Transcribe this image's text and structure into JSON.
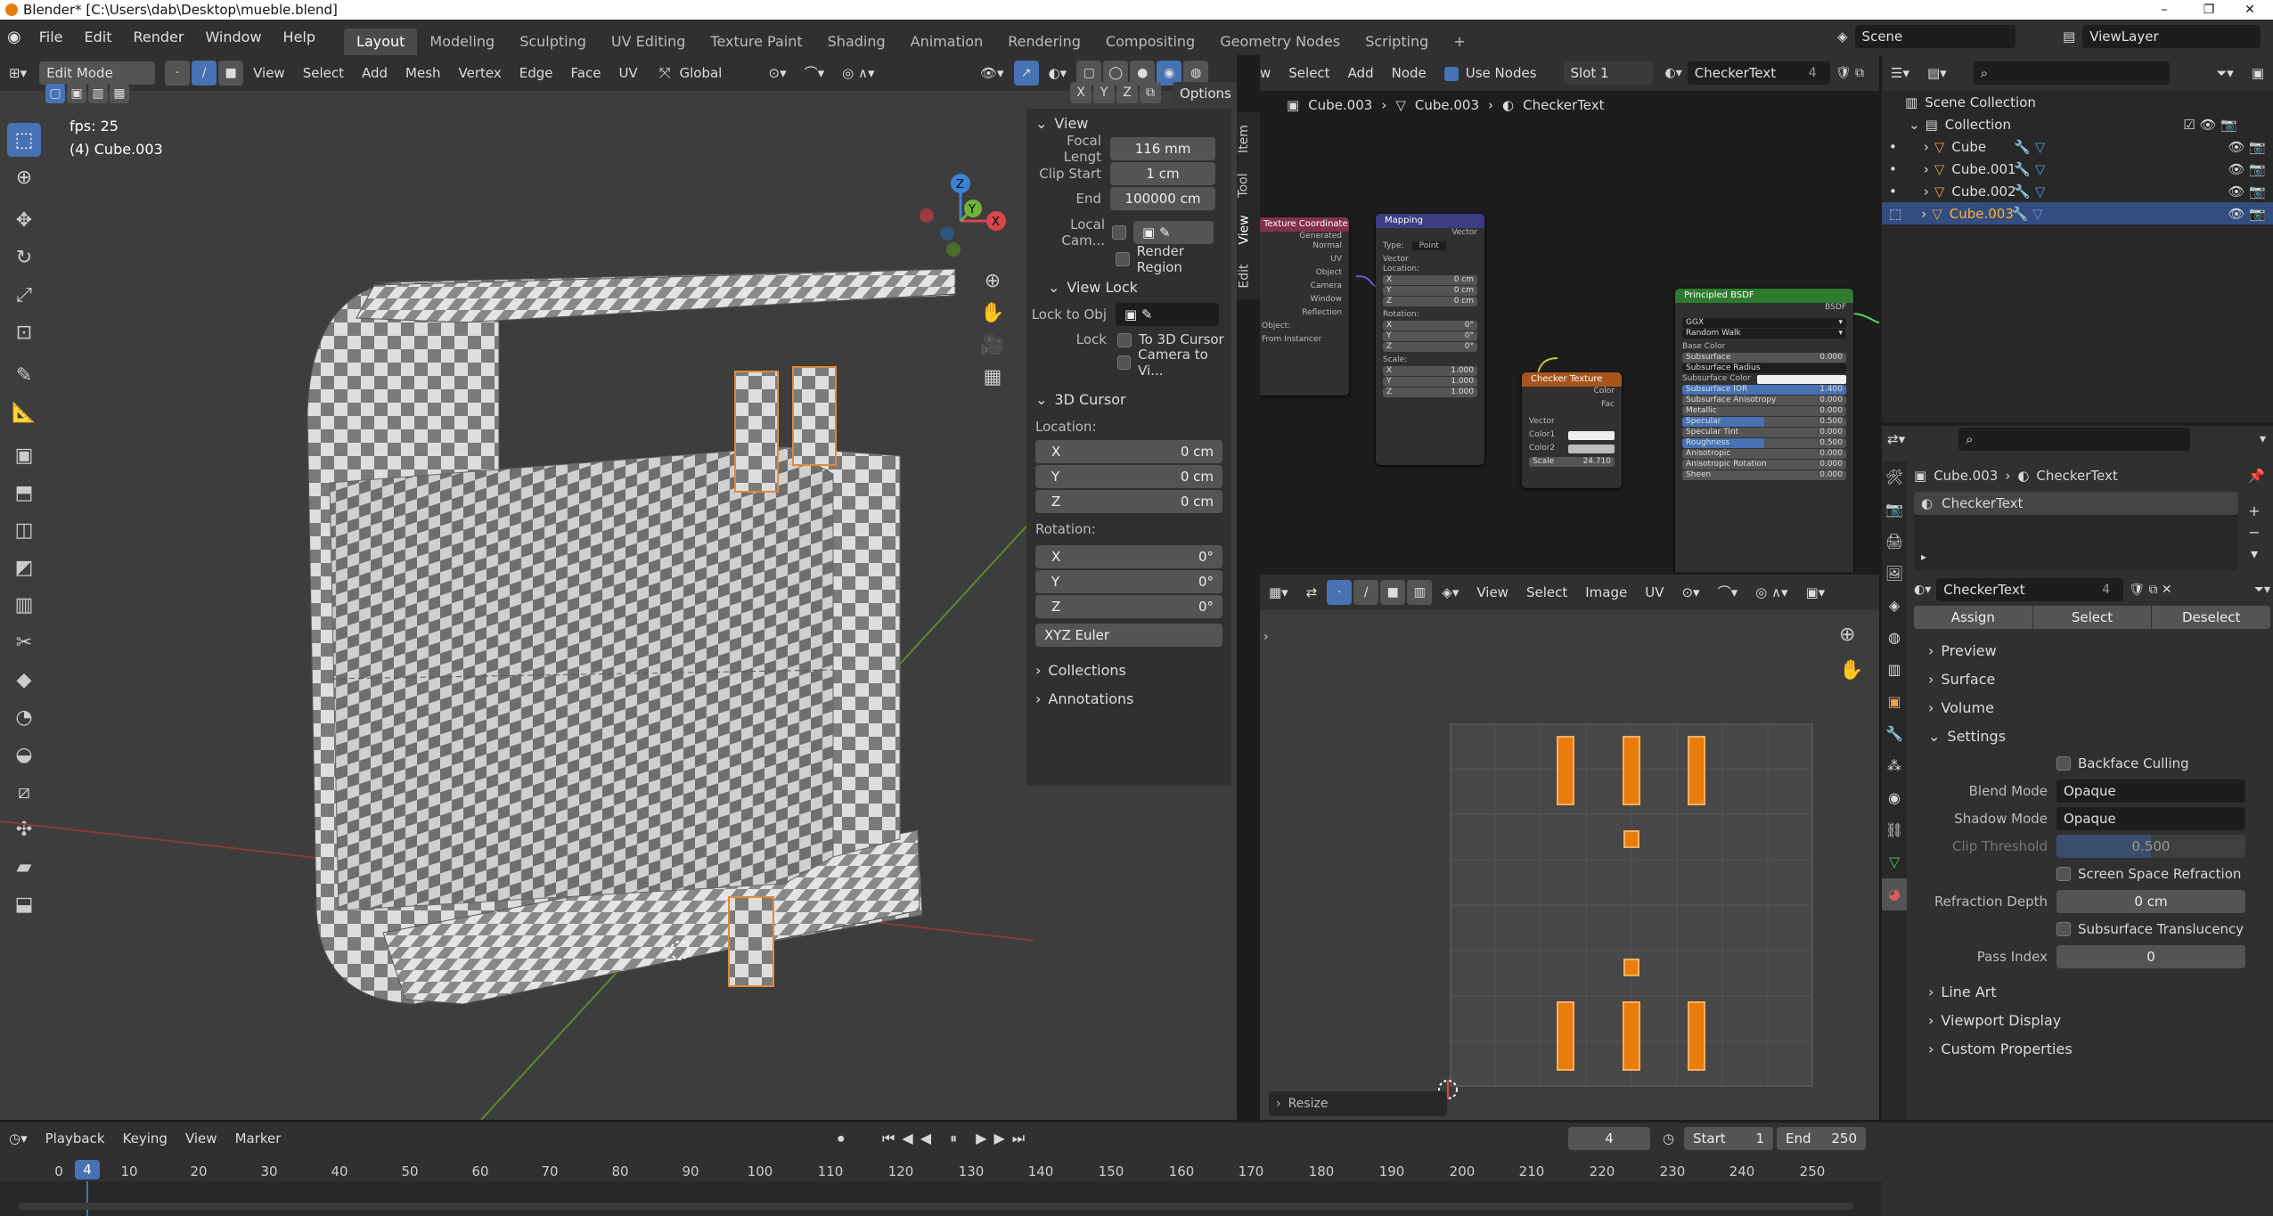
{
  "title": "Blender* [C:\\Users\\dab\\Desktop\\mueble.blend]",
  "window_controls": [
    "–",
    "❐",
    "✕"
  ],
  "menu": [
    "File",
    "Edit",
    "Render",
    "Window",
    "Help"
  ],
  "workspaces": [
    "Layout",
    "Modeling",
    "Sculpting",
    "UV Editing",
    "Texture Paint",
    "Shading",
    "Animation",
    "Rendering",
    "Compositing",
    "Geometry Nodes",
    "Scripting"
  ],
  "add_ws": "+",
  "scene": "Scene",
  "viewlayer": "ViewLayer",
  "viewport": {
    "mode": "Edit Mode",
    "menus": [
      "View",
      "Select",
      "Add",
      "Mesh",
      "Vertex",
      "Edge",
      "Face",
      "UV"
    ],
    "orientation": "Global",
    "axes": [
      "X",
      "Y",
      "Z"
    ],
    "options": "Options",
    "fps": "fps: 25",
    "object": "(4) Cube.003",
    "gizmo": {
      "x": "X",
      "y": "Y",
      "z": "Z"
    }
  },
  "npanel": {
    "tabs": [
      "Item",
      "Tool",
      "View",
      "Edit"
    ],
    "view_header": "View",
    "focal_label": "Focal Lengt",
    "focal_value": "116 mm",
    "clip_start_label": "Clip Start",
    "clip_start_value": "1 cm",
    "end_label": "End",
    "end_value": "100000 cm",
    "local_cam_label": "Local Cam...",
    "render_region": "Render Region",
    "view_lock": "View Lock",
    "lock_obj_label": "Lock to Obj",
    "lock_label": "Lock",
    "to_3d_cursor": "To 3D Cursor",
    "camera_to_view": "Camera to Vi...",
    "cursor_header": "3D Cursor",
    "location": "Location:",
    "loc": [
      {
        "axis": "X",
        "value": "0 cm"
      },
      {
        "axis": "Y",
        "value": "0 cm"
      },
      {
        "axis": "Z",
        "value": "0 cm"
      }
    ],
    "rotation": "Rotation:",
    "rot": [
      {
        "axis": "X",
        "value": "0°"
      },
      {
        "axis": "Y",
        "value": "0°"
      },
      {
        "axis": "Z",
        "value": "0°"
      }
    ],
    "rotation_mode": "XYZ Euler",
    "collections": "Collections",
    "annotations": "Annotations"
  },
  "node_editor": {
    "menus": [
      "w",
      "Select",
      "Add",
      "Node"
    ],
    "use_nodes": "Use Nodes",
    "slot": "Slot 1",
    "material": "CheckerText",
    "users": "4",
    "breadcrumb": [
      "Cube.003",
      "Cube.003",
      "CheckerText"
    ],
    "tex_coord": {
      "title": "Texture Coordinate",
      "outputs": [
        "Generated",
        "Normal",
        "UV",
        "Object",
        "Camera",
        "Window",
        "Reflection"
      ],
      "object_label": "Object:",
      "from_instancer": "From Instancer"
    },
    "mapping": {
      "title": "Mapping",
      "out": "Vector",
      "type_label": "Type:",
      "type_value": "Point",
      "vector": "Vector",
      "location": "Location:",
      "rotation": "Rotation:",
      "scale": "Scale:",
      "loc": [
        {
          "a": "X",
          "v": "0 cm"
        },
        {
          "a": "Y",
          "v": "0 cm"
        },
        {
          "a": "Z",
          "v": "0 cm"
        }
      ],
      "rot": [
        {
          "a": "X",
          "v": "0°"
        },
        {
          "a": "Y",
          "v": "0°"
        },
        {
          "a": "Z",
          "v": "0°"
        }
      ],
      "scl": [
        {
          "a": "X",
          "v": "1.000"
        },
        {
          "a": "Y",
          "v": "1.000"
        },
        {
          "a": "Z",
          "v": "1.000"
        }
      ]
    },
    "checker": {
      "title": "Checker Texture",
      "out_color": "Color",
      "out_fac": "Fac",
      "vector": "Vector",
      "color1": "Color1",
      "color2": "Color2",
      "scale_label": "Scale",
      "scale": "24.710"
    },
    "bsdf": {
      "title": "Principled BSDF",
      "out": "BSDF",
      "dist": "GGX",
      "sss": "Random Walk",
      "base_color": "Base Color",
      "fields": [
        {
          "n": "Subsurface",
          "v": "0.000",
          "blue": false
        },
        {
          "n": "Subsurface Radius",
          "v": "",
          "blue": false
        },
        {
          "n": "Subsurface Color",
          "v": "",
          "blue": false
        },
        {
          "n": "Subsurface IOR",
          "v": "1.400",
          "blue": true
        },
        {
          "n": "Subsurface Anisotropy",
          "v": "0.000",
          "blue": false
        },
        {
          "n": "Metallic",
          "v": "0.000",
          "blue": false
        },
        {
          "n": "Specular",
          "v": "0.500",
          "blue": true
        },
        {
          "n": "Specular Tint",
          "v": "0.000",
          "blue": false
        },
        {
          "n": "Roughness",
          "v": "0.500",
          "blue": true
        },
        {
          "n": "Anisotropic",
          "v": "0.000",
          "blue": false
        },
        {
          "n": "Anisotropic Rotation",
          "v": "0.000",
          "blue": false
        },
        {
          "n": "Sheen",
          "v": "0.000",
          "blue": false
        }
      ]
    }
  },
  "uv_editor": {
    "menus": [
      "View",
      "Select",
      "Image",
      "UV"
    ],
    "last_op": "Resize"
  },
  "outliner": {
    "scene_collection": "Scene Collection",
    "collection": "Collection",
    "items": [
      "Cube",
      "Cube.001",
      "Cube.002",
      "Cube.003"
    ]
  },
  "properties": {
    "breadcrumb": [
      "Cube.003",
      "CheckerText"
    ],
    "slot_name": "CheckerText",
    "material": "CheckerText",
    "users": "4",
    "assign": "Assign",
    "select": "Select",
    "deselect": "Deselect",
    "sections": [
      "Preview",
      "Surface",
      "Volume",
      "Settings"
    ],
    "backface": "Backface Culling",
    "blend_label": "Blend Mode",
    "blend": "Opaque",
    "shadow_label": "Shadow Mode",
    "shadow": "Opaque",
    "clip_label": "Clip Threshold",
    "clip": "0.500",
    "ssr": "Screen Space Refraction",
    "refr_label": "Refraction Depth",
    "refr": "0 cm",
    "sst": "Subsurface Translucency",
    "pass_label": "Pass Index",
    "pass": "0",
    "sections2": [
      "Line Art",
      "Viewport Display",
      "Custom Properties"
    ]
  },
  "timeline": {
    "menus": [
      "Playback",
      "Keying",
      "View",
      "Marker"
    ],
    "current": "4",
    "start_label": "Start",
    "start": "1",
    "end_label": "End",
    "end": "250",
    "ticks": [
      "0",
      "10",
      "20",
      "30",
      "40",
      "50",
      "60",
      "70",
      "80",
      "90",
      "100",
      "110",
      "120",
      "130",
      "140",
      "150",
      "160",
      "170",
      "180",
      "190",
      "200",
      "210",
      "220",
      "230",
      "240",
      "250"
    ]
  }
}
